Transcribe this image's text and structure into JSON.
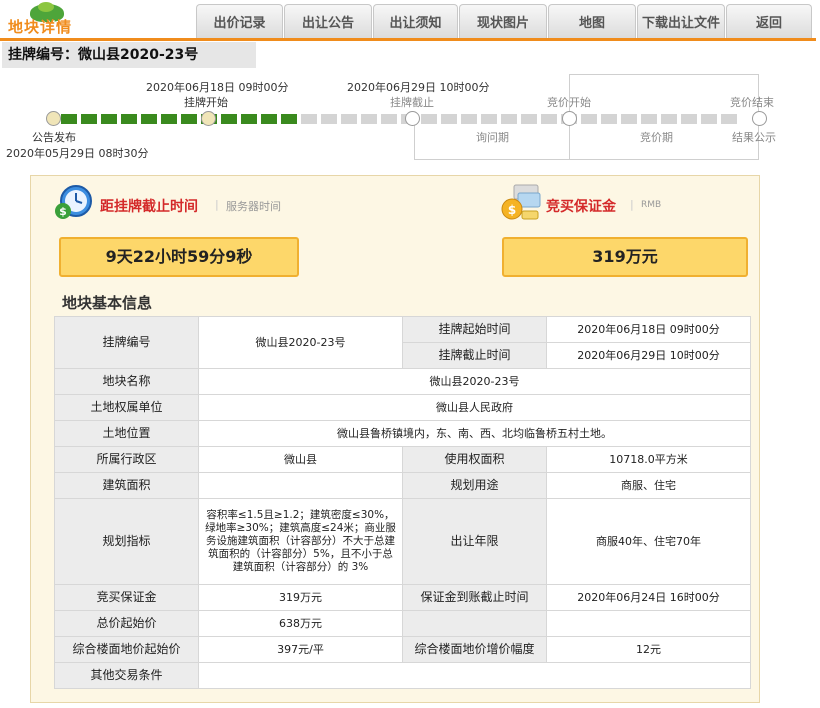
{
  "logo": {
    "title": "地块详情"
  },
  "nav": {
    "tabs": [
      "出价记录",
      "出让公告",
      "出让须知",
      "现状图片",
      "地图",
      "下载出让文件",
      "返回"
    ]
  },
  "parcel_code_label": "挂牌编号：微山县2020-23号",
  "timeline": {
    "listing_start_time": "2020年06月18日  09时00分",
    "listing_start_label": "挂牌开始",
    "listing_end_time": "2020年06月29日  10时00分",
    "listing_end_label": "挂牌截止",
    "bid_start_label": "竞价开始",
    "bid_end_label": "竞价结束",
    "announcement_label": "公告发布",
    "announcement_time": "2020年05月29日  08时30分",
    "inquiry_period_label": "询问期",
    "bid_period_label": "竞价期",
    "result_label": "结果公示",
    "progress_fraction": 0.36
  },
  "countdown": {
    "title": "距挂牌截止时间",
    "sub": "服务器时间",
    "value": "9天22小时59分9秒"
  },
  "deposit": {
    "title": "竞买保证金",
    "sub": "RMB",
    "value": "319万元"
  },
  "section_title": "地块基本信息",
  "table": {
    "listing_no_label": "挂牌编号",
    "listing_no": "微山县2020-23号",
    "start_time_label": "挂牌起始时间",
    "start_time": "2020年06月18日 09时00分",
    "end_time_label": "挂牌截止时间",
    "end_time": "2020年06月29日 10时00分",
    "parcel_name_label": "地块名称",
    "parcel_name": "微山县2020-23号",
    "owner_label": "土地权属单位",
    "owner": "微山县人民政府",
    "location_label": "土地位置",
    "location": "微山县鲁桥镇境内，东、南、西、北均临鲁桥五村土地。",
    "district_label": "所属行政区",
    "district": "微山县",
    "use_area_label": "使用权面积",
    "use_area": "10718.0平方米",
    "build_area_label": "建筑面积",
    "build_area": "",
    "plan_use_label": "规划用途",
    "plan_use": "商服、住宅",
    "plan_index_label": "规划指标",
    "plan_index": "容积率≤1.5且≥1.2；建筑密度≤30%，绿地率≥30%；建筑高度≤24米；商业服务设施建筑面积（计容部分）不大于总建筑面积的（计容部分）5%，且不小于总建筑面积（计容部分）的 3%",
    "term_label": "出让年限",
    "term": "商服40年、住宅70年",
    "deposit_label": "竞买保证金",
    "deposit": "319万元",
    "deposit_deadline_label": "保证金到账截止时间",
    "deposit_deadline": "2020年06月24日 16时00分",
    "start_price_label": "总价起始价",
    "start_price": "638万元",
    "floor_price_label": "综合楼面地价起始价",
    "floor_price": "397元/平",
    "increment_label": "综合楼面地价增价幅度",
    "increment": "12元",
    "other_label": "其他交易条件",
    "other": ""
  },
  "colors": {
    "accent_orange": "#f08c1c",
    "progress_green": "#3a8a1e",
    "highlight_yellow": "#fdd76a",
    "title_red": "#d42a2a"
  }
}
